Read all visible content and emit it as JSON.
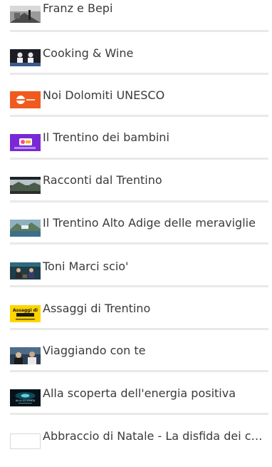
{
  "playlist": {
    "items": [
      {
        "title": "Franz e Bepi",
        "thumb_icon": "thumbnail-street-photo"
      },
      {
        "title": "Cooking & Wine",
        "thumb_icon": "thumbnail-chefs"
      },
      {
        "title": "Noi Dolomiti UNESCO",
        "thumb_icon": "thumbnail-orange-logo"
      },
      {
        "title": "Il Trentino dei bambini",
        "thumb_icon": "thumbnail-purple-kids"
      },
      {
        "title": "Racconti dal Trentino",
        "thumb_icon": "thumbnail-landscape"
      },
      {
        "title": "Il Trentino Alto Adige delle meraviglie",
        "thumb_icon": "thumbnail-mountain-lake"
      },
      {
        "title": "Toni Marci scio'",
        "thumb_icon": "thumbnail-studio"
      },
      {
        "title": "Assaggi di Trentino",
        "thumb_icon": "thumbnail-yellow-title"
      },
      {
        "title": "Viaggiando con te",
        "thumb_icon": "thumbnail-interview"
      },
      {
        "title": "Alla scoperta dell'energia positiva",
        "thumb_icon": "thumbnail-dark-glow"
      },
      {
        "title": "Abbraccio di Natale - La disfida dei cuochi",
        "thumb_icon": "thumbnail-blank"
      }
    ],
    "thumb_texts": {
      "assaggi": "Assaggi di",
      "energia": "ALLA SCOPERTA"
    }
  }
}
